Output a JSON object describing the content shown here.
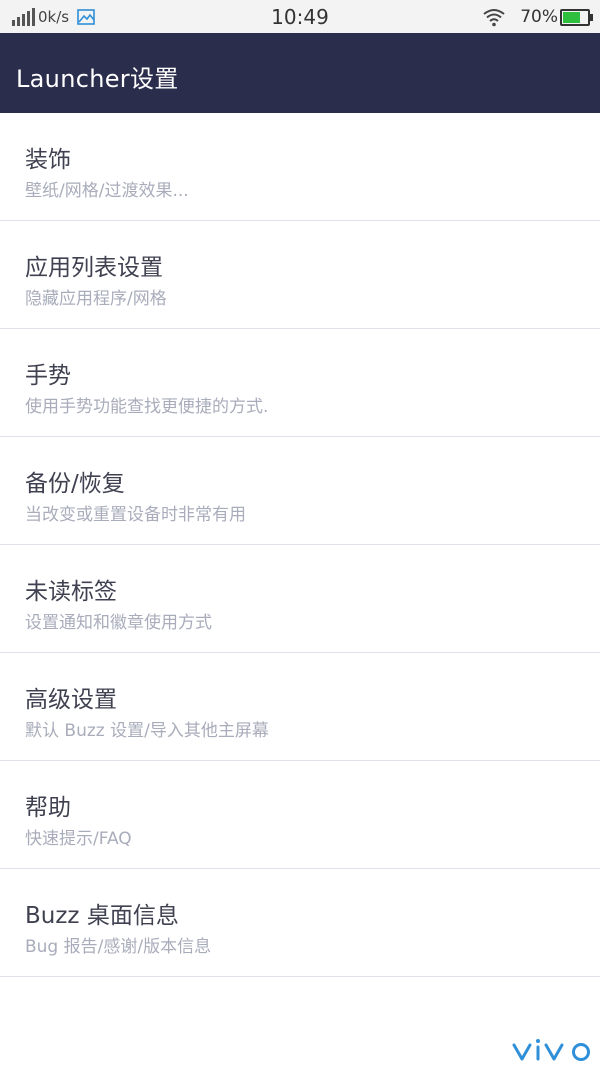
{
  "status_bar": {
    "network_speed": "0k/s",
    "time": "10:49",
    "battery_percent": "70%",
    "battery_level": 0.7,
    "icons": [
      "signal-icon",
      "image-icon",
      "wifi-icon",
      "battery-icon"
    ]
  },
  "app_bar": {
    "title": "Launcher设置"
  },
  "settings": [
    {
      "title": "装饰",
      "subtitle": "壁纸/网格/过渡效果..."
    },
    {
      "title": "应用列表设置",
      "subtitle": "隐藏应用程序/网格"
    },
    {
      "title": "手势",
      "subtitle": "使用手势功能查找更便捷的方式."
    },
    {
      "title": "备份/恢复",
      "subtitle": "当改变或重置设备时非常有用"
    },
    {
      "title": "未读标签",
      "subtitle": "设置通知和徽章使用方式"
    },
    {
      "title": "高级设置",
      "subtitle": "默认 Buzz 设置/导入其他主屏幕"
    },
    {
      "title": "帮助",
      "subtitle": "快速提示/FAQ"
    },
    {
      "title": "Buzz 桌面信息",
      "subtitle": "Bug 报告/感谢/版本信息"
    }
  ],
  "brand": {
    "logo": "vivo",
    "color": "#2f8fd8"
  },
  "colors": {
    "app_bar": "#2b2d4c",
    "divider": "#dfe2ec",
    "title": "#3f4150",
    "subtitle": "#a9adbb"
  }
}
